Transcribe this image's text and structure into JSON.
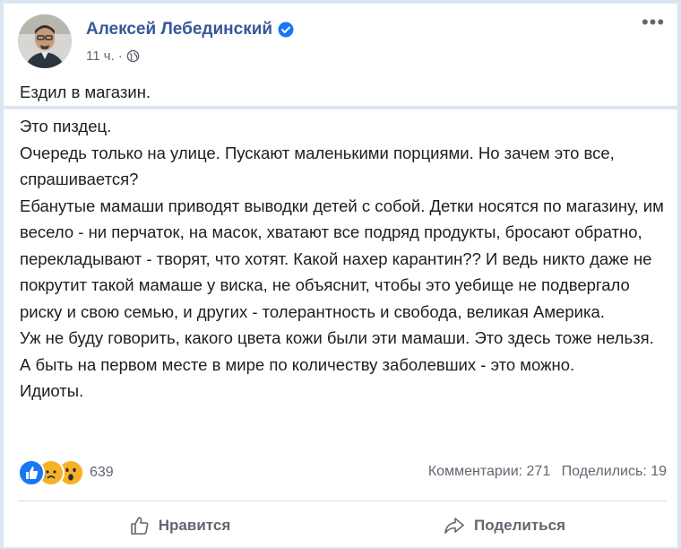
{
  "post": {
    "author": "Алексей Лебединский",
    "time": "11 ч.",
    "time_separator": "·",
    "intro": "Ездил в магазин.",
    "body": [
      "Это пиздец.",
      "Очередь только на улице. Пускают маленькими порциями. Но зачем это все, спрашивается?",
      "Ебанутые мамаши приводят выводки детей с собой. Детки носятся по магазину, им весело - ни перчаток, на масок, хватают все подряд продукты, бросают обратно, перекладывают - творят, что хотят. Какой нахер карантин?? И ведь никто даже не покрутит такой мамаше у виска, не объяснит, чтобы это уебище не подвергало риску и свою семью, и других - толерантность и свобода, великая Америка.",
      "Уж не буду говорить, какого цвета кожи были эти мамаши. Это здесь тоже нельзя. А быть на первом месте в мире по количеству заболевших - это можно.",
      "Идиоты."
    ]
  },
  "stats": {
    "reactions": [
      "like-icon",
      "sad-icon",
      "wow-icon"
    ],
    "reaction_count": "639",
    "comments": "Комментарии: 271",
    "shares": "Поделились: 19"
  },
  "actions": {
    "like_label": "Нравится",
    "share_label": "Поделиться"
  },
  "colors": {
    "author": "#365899",
    "accent": "#1877f2",
    "background": "#dbe5f1",
    "muted": "#606770"
  }
}
